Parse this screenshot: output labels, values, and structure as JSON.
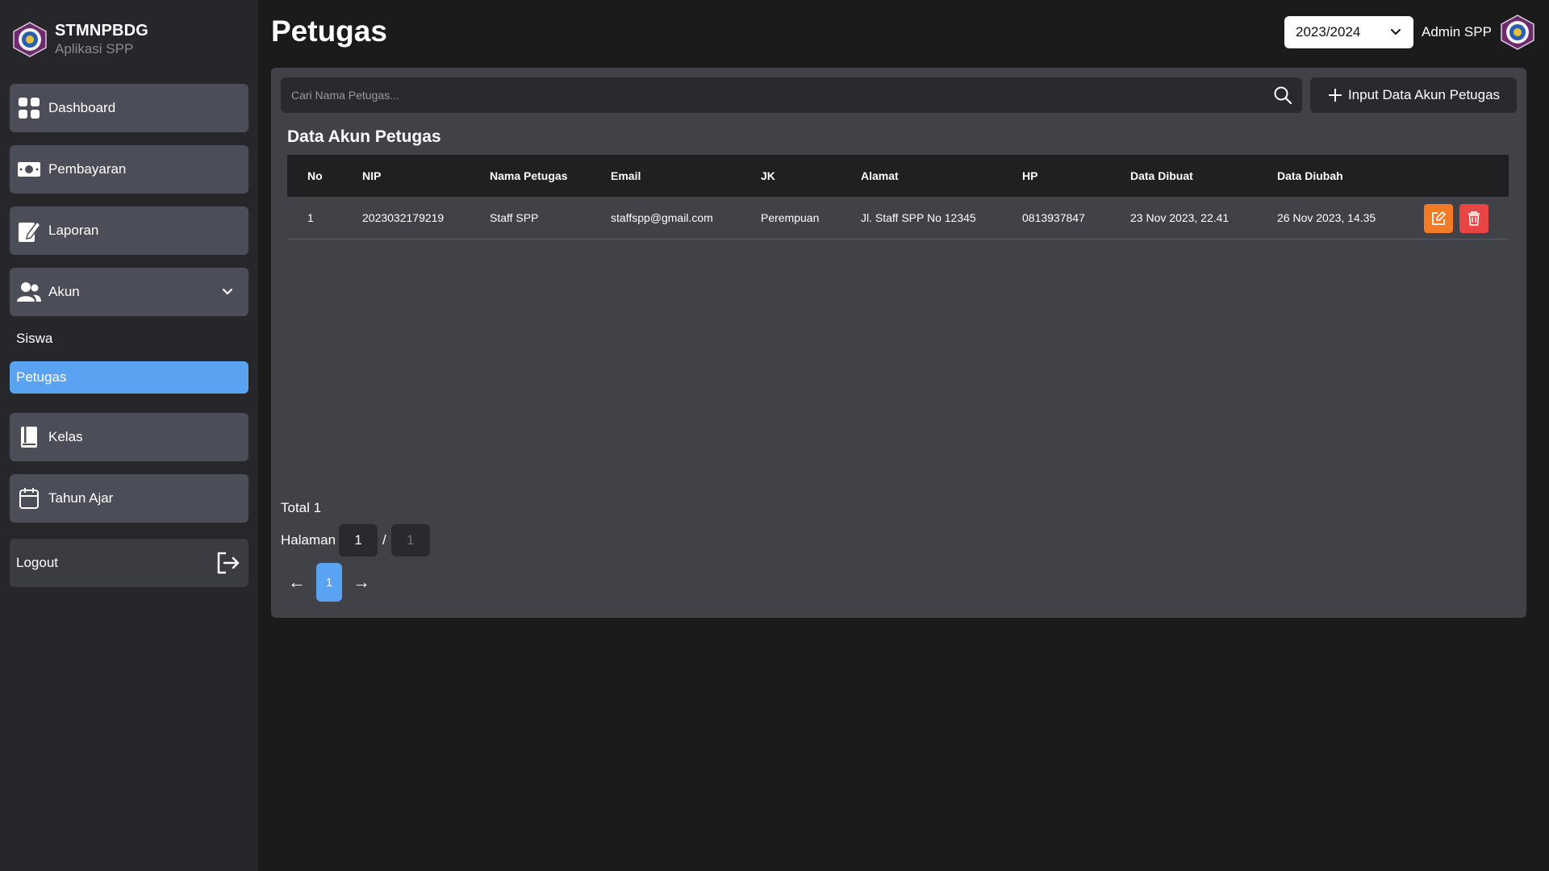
{
  "brand": {
    "name": "STMNPBDG",
    "subtitle": "Aplikasi SPP"
  },
  "sidebar": {
    "items": [
      {
        "label": "Dashboard",
        "icon": "grid-icon"
      },
      {
        "label": "Pembayaran",
        "icon": "money-icon"
      },
      {
        "label": "Laporan",
        "icon": "report-edit-icon"
      },
      {
        "label": "Akun",
        "icon": "users-icon",
        "expanded": true
      },
      {
        "label": "Kelas",
        "icon": "book-icon"
      },
      {
        "label": "Tahun Ajar",
        "icon": "calendar-icon"
      }
    ],
    "sub_items": [
      {
        "label": "Siswa",
        "active": false
      },
      {
        "label": "Petugas",
        "active": true
      }
    ],
    "logout_label": "Logout"
  },
  "header": {
    "title": "Petugas",
    "year_selected": "2023/2024",
    "user_name": "Admin SPP"
  },
  "search": {
    "placeholder": "Cari Nama Petugas..."
  },
  "add_button_label": "Input Data Akun Petugas",
  "section_title": "Data Akun Petugas",
  "table": {
    "columns": [
      "No",
      "NIP",
      "Nama Petugas",
      "Email",
      "JK",
      "Alamat",
      "HP",
      "Data Dibuat",
      "Data Diubah"
    ],
    "rows": [
      {
        "no": "1",
        "nip": "2023032179219",
        "nama": "Staff SPP",
        "email": "staffspp@gmail.com",
        "jk": "Perempuan",
        "alamat": "Jl. Staff SPP No 12345",
        "hp": "0813937847",
        "dibuat": "23 Nov 2023, 22.41",
        "diubah": "26 Nov 2023, 14.35"
      }
    ]
  },
  "pagination": {
    "total_label": "Total 1",
    "page_label": "Halaman",
    "current_page": "1",
    "separator": "/",
    "total_pages": "1",
    "prev": "←",
    "next": "→",
    "page_button": "1"
  },
  "colors": {
    "accent": "#5aa3f2",
    "edit": "#f47a26",
    "delete": "#e94545",
    "sidebar_bg": "#27272b",
    "nav_item_bg": "#4b4e58",
    "card_bg": "#404248"
  }
}
